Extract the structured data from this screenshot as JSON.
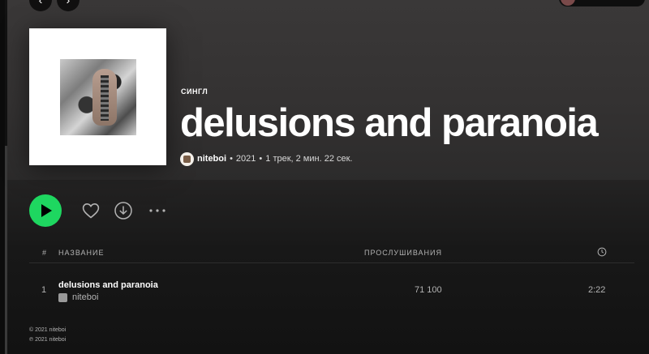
{
  "album": {
    "type_label": "СИНГЛ",
    "title": "delusions and paranoia",
    "artist": "niteboi",
    "year": "2021",
    "summary": "1 трек, 2 мин. 22 сек."
  },
  "tracklist": {
    "columns": {
      "number": "#",
      "title": "НАЗВАНИЕ",
      "plays": "ПРОСЛУШИВАНИЯ"
    },
    "tracks": [
      {
        "number": "1",
        "title": "delusions and paranoia",
        "artist": "niteboi",
        "plays": "71 100",
        "duration": "2:22"
      }
    ]
  },
  "footer": {
    "copyright": "© 2021 niteboi",
    "phonogram": "℗ 2021 niteboi"
  },
  "icons": {
    "nav_back": "chevron-left-icon",
    "nav_forward": "chevron-right-icon",
    "play": "play-icon",
    "like": "heart-icon",
    "download": "download-icon",
    "more": "more-icon",
    "duration": "clock-icon"
  },
  "colors": {
    "accent": "#1ed760",
    "background": "#121212",
    "header": "#3a3838",
    "muted_text": "#b3b3b3"
  }
}
